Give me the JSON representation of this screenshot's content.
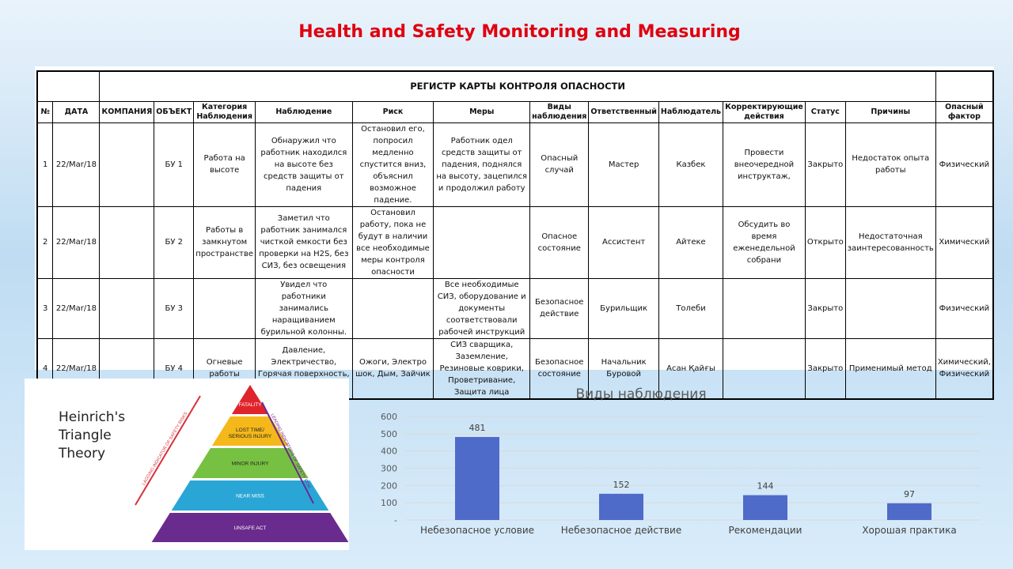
{
  "slide_title": "Health and Safety Monitoring and Measuring",
  "register": {
    "title": "РЕГИСТР КАРТЫ КОНТРОЛЯ ОПАСНОСТИ",
    "headers": [
      "№",
      "ДАТА",
      "КОМПАНИЯ",
      "ОБЪЕКТ",
      "Категория Наблюдения",
      "Наблюдение",
      "Риск",
      "Меры",
      "Виды наблюдения",
      "Ответственный",
      "Наблюдатель",
      "Корректирующие действия",
      "Статус",
      "Причины",
      "Опасный фактор"
    ],
    "rows": [
      [
        "1",
        "22/Mar/18",
        "",
        "БУ 1",
        "Работа на высоте",
        "Обнаружил что работник находился на высоте без средств защиты от падения",
        "Остановил его, попросил медленно спустится вниз, объяснил возможное падение.",
        "Работник одел средств защиты от падения, поднялся на высоту, зацепился и продолжил работу",
        "Опасный случай",
        "Мастер",
        "Казбек",
        "Провести внеочередной инструктаж,",
        "Закрыто",
        "Недостаток опыта работы",
        "Физический"
      ],
      [
        "2",
        "22/Mar/18",
        "",
        "БУ 2",
        "Работы в замкнутом пространстве",
        "Заметил что работник занимался чисткой емкости без проверки на H2S, без СИЗ, без освещения",
        "Остановил работу, пока не будут в наличии все необходимые меры контроля опасности",
        "",
        "Опасное состояние",
        "Ассистент",
        "Айтеке",
        "Обсудить во время еженедельной собрани",
        "Открыто",
        "Недостаточная заинтересованность",
        "Химический"
      ],
      [
        "3",
        "22/Mar/18",
        "",
        "БУ 3",
        "",
        "Увидел что работники занимались наращиванием бурильной колонны.",
        "",
        "Все необходимые СИЗ, оборудование и документы соответствовали рабочей инструкций",
        "Безопасное действие",
        "Бурильщик",
        "Толеби",
        "",
        "Закрыто",
        "",
        "Физический"
      ],
      [
        "4",
        "22/Mar/18",
        "",
        "БУ 4",
        "Огневые работы",
        "Давление, Электричество, Горячая поверхность, Раздражающий",
        "Ожоги, Электро шок, Дым, Зайчик",
        "СИЗ сварщика, Заземление, Резиновые коврики, Проветривание, Защита лица",
        "Безопасное состояние",
        "Начальник Буровой",
        "Асан Қайғы",
        "",
        "Закрыто",
        "Применимый метод",
        "Химический, Физический"
      ]
    ]
  },
  "triangle": {
    "title_lines": [
      "Heinrich's",
      "Triangle",
      "Theory"
    ],
    "levels": [
      {
        "label": "FATALITY",
        "color": "#e0242b"
      },
      {
        "label": "LOST TIME/ SERIOUS INJURY",
        "color": "#f5b81b"
      },
      {
        "label": "MINOR INJURY",
        "color": "#77c142"
      },
      {
        "label": "NEAR MISS",
        "color": "#2aa6d6"
      },
      {
        "label": "UNSAFE ACT",
        "color": "#6a2b8e"
      }
    ],
    "left_arrow": "LAGGING INDICATOR OF SAFETY RISKS",
    "right_arrow": "LEADING INDICATORS OF SAFETY RISK"
  },
  "chart_data": {
    "type": "bar",
    "title": "Виды наблюдения",
    "categories": [
      "Небезопасное условие",
      "Небезопасное действие",
      "Рекомендации",
      "Хорошая практика"
    ],
    "values": [
      481,
      152,
      144,
      97
    ],
    "ylim": [
      0,
      600
    ],
    "yticks": [
      "-",
      "100",
      "200",
      "300",
      "400",
      "500",
      "600"
    ],
    "xlabel": "",
    "ylabel": "",
    "grid": true,
    "bar_color": "#4e6bc9"
  }
}
